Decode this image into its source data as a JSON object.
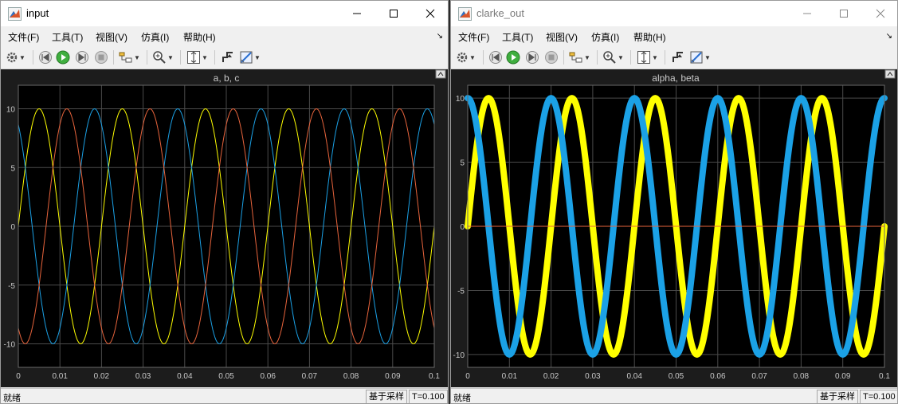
{
  "colors": {
    "plot_bg": "#1c1c1c",
    "axes_bg": "#000000",
    "grid": "#4a4a4a",
    "tick_text": "#c8c8c8",
    "yellow": "#ffff00",
    "blue": "#1ba1e6",
    "orange": "#e8643c"
  },
  "windows": [
    {
      "title": "input",
      "menu": [
        "文件(F)",
        "工具(T)",
        "视图(V)",
        "仿真(I)",
        "帮助(H)"
      ],
      "plot_title": "a, b, c",
      "status": {
        "ready": "就绪",
        "mode": "基于采样",
        "time": "T=0.100"
      }
    },
    {
      "title": "clarke_out",
      "menu": [
        "文件(F)",
        "工具(T)",
        "视图(V)",
        "仿真(I)",
        "帮助(H)"
      ],
      "plot_title": "alpha, beta",
      "status": {
        "ready": "就绪",
        "mode": "基于采样",
        "time": "T=0.100"
      }
    }
  ],
  "chart_data": [
    {
      "type": "line",
      "title": "a, b, c",
      "xlim": [
        0,
        0.1
      ],
      "ylim": [
        -12,
        12
      ],
      "x_ticks": [
        "0",
        "0.01",
        "0.02",
        "0.03",
        "0.04",
        "0.05",
        "0.06",
        "0.07",
        "0.08",
        "0.09",
        "0.1"
      ],
      "y_ticks": [
        "10",
        "5",
        "0",
        "-5",
        "-10"
      ],
      "grid": true,
      "x": [
        0,
        0.01,
        0.02,
        0.03,
        0.04,
        0.05,
        0.06,
        0.07,
        0.08,
        0.09,
        0.1
      ],
      "series": [
        {
          "color": "yellow",
          "y": [
            0,
            9.51,
            5.88,
            -5.88,
            -9.51,
            0,
            9.51,
            5.88,
            -5.88,
            -9.51,
            0
          ]
        },
        {
          "color": "blue",
          "y": [
            8.66,
            -0.52,
            -9.14,
            -8.09,
            1.57,
            9.51,
            7.43,
            -2.59,
            -9.78,
            -6.69,
            3.59
          ]
        },
        {
          "color": "orange",
          "y": [
            -8.66,
            -8.99,
            3.26,
            9.97,
            7.94,
            -9.51,
            -8.99,
            3.26,
            9.97,
            7.94,
            -8.66
          ]
        }
      ]
    },
    {
      "type": "line",
      "title": "alpha, beta",
      "xlim": [
        0,
        0.1
      ],
      "ylim": [
        -11,
        11
      ],
      "x_ticks": [
        "0",
        "0.01",
        "0.02",
        "0.03",
        "0.04",
        "0.05",
        "0.06",
        "0.07",
        "0.08",
        "0.09",
        "0.1"
      ],
      "y_ticks": [
        "10",
        "5",
        "0",
        "-5",
        "-10"
      ],
      "grid": true,
      "x": [
        0,
        0.01,
        0.02,
        0.03,
        0.04,
        0.05,
        0.06,
        0.07,
        0.08,
        0.09,
        0.1
      ],
      "series": [
        {
          "color": "yellow",
          "thick": true,
          "y": [
            0,
            9.51,
            5.88,
            -5.88,
            -9.51,
            0,
            9.51,
            5.88,
            -5.88,
            -9.51,
            0
          ]
        },
        {
          "color": "blue",
          "thick": true,
          "y": [
            10,
            3.09,
            -8.09,
            -8.09,
            3.09,
            10,
            3.09,
            -8.09,
            -8.09,
            3.09,
            10
          ]
        },
        {
          "color": "orange",
          "y": [
            0,
            0,
            0,
            0,
            0,
            0,
            0,
            0,
            0,
            0,
            0
          ]
        }
      ]
    }
  ]
}
